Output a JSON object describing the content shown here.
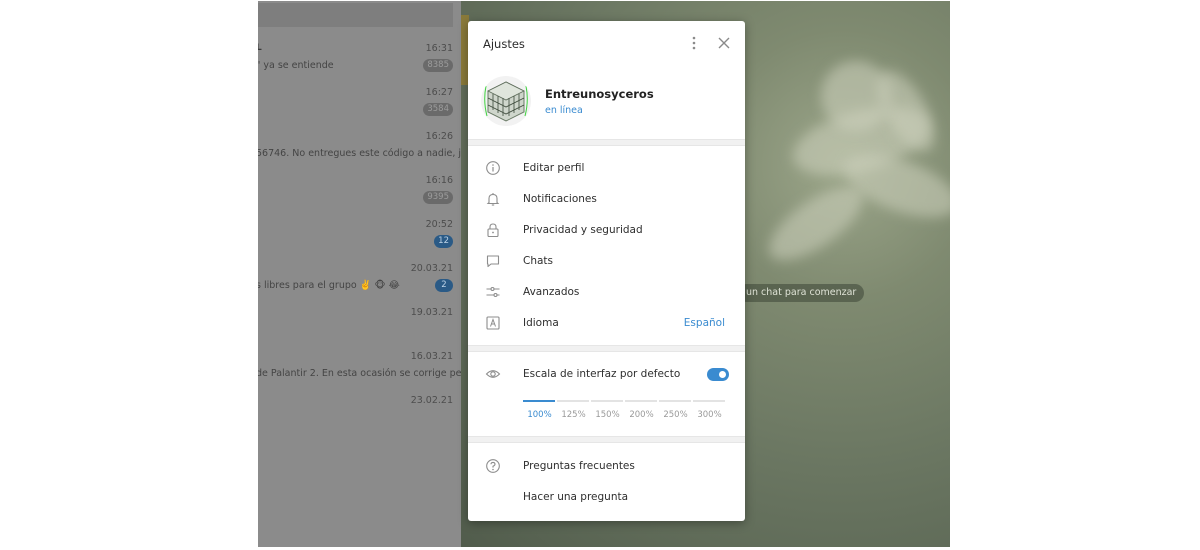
{
  "chat_list": {
    "chats": [
      {
        "title": "L",
        "time": "16:31",
        "preview": "\" ya se entiende",
        "badge": "8385",
        "badge_style": "muted"
      },
      {
        "title": "",
        "time": "16:27",
        "preview": "",
        "badge": "3584",
        "badge_style": "muted"
      },
      {
        "title": "",
        "time": "16:26",
        "preview": "56746. No entregues este código a nadie, j...",
        "badge": "",
        "badge_style": ""
      },
      {
        "title": "",
        "time": "16:16",
        "preview": "",
        "badge": "9395",
        "badge_style": "muted"
      },
      {
        "title": "",
        "time": "20:52",
        "preview": "",
        "badge": "12",
        "badge_style": "blue"
      },
      {
        "title": "",
        "time": "20.03.21",
        "preview": "s libres para el grupo ✌️ 🐵 😂",
        "badge": "2",
        "badge_style": "blue"
      },
      {
        "title": "",
        "time": "19.03.21",
        "preview": "",
        "badge": "",
        "badge_style": ""
      },
      {
        "title": "",
        "time": "16.03.21",
        "preview": "de Palantir 2. En esta ocasión se corrige peq...",
        "badge": "",
        "badge_style": ""
      },
      {
        "title": "",
        "time": "23.02.21",
        "preview": "",
        "badge": "",
        "badge_style": ""
      }
    ]
  },
  "chat_area": {
    "empty_hint": "un chat para comenzar"
  },
  "settings": {
    "title": "Ajustes",
    "profile": {
      "name": "Entreunosyceros",
      "status": "en línea"
    },
    "menu": [
      {
        "label": "Editar perfil",
        "icon": "info-icon"
      },
      {
        "label": "Notificaciones",
        "icon": "bell-icon"
      },
      {
        "label": "Privacidad y seguridad",
        "icon": "lock-icon"
      },
      {
        "label": "Chats",
        "icon": "chat-bubble-icon"
      },
      {
        "label": "Avanzados",
        "icon": "sliders-icon"
      },
      {
        "label": "Idioma",
        "icon": "letter-a-icon",
        "value": "Español"
      }
    ],
    "interface_scale": {
      "label": "Escala de interfaz por defecto",
      "default_enabled": true,
      "options": [
        "100%",
        "125%",
        "150%",
        "200%",
        "250%",
        "300%"
      ],
      "selected": "100%"
    },
    "help": [
      {
        "label": "Preguntas frecuentes",
        "icon": "question-icon"
      },
      {
        "label": "Hacer una pregunta",
        "icon": ""
      }
    ]
  },
  "colors": {
    "accent": "#3a8bd0",
    "overlay_dim": "#8b8b8b"
  }
}
